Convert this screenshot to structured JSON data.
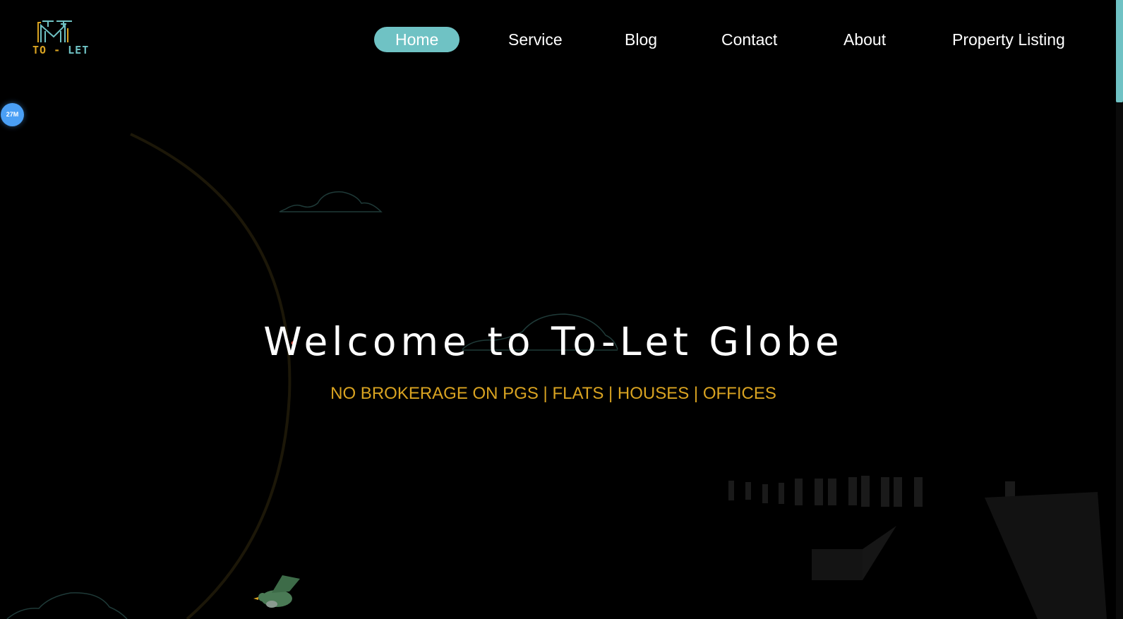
{
  "logo": {
    "text_to": "TO",
    "text_dash": " - ",
    "text_let": "LET"
  },
  "nav": {
    "items": [
      {
        "label": "Home",
        "active": true
      },
      {
        "label": "Service",
        "active": false
      },
      {
        "label": "Blog",
        "active": false
      },
      {
        "label": "Contact",
        "active": false
      },
      {
        "label": "About",
        "active": false
      },
      {
        "label": "Property Listing",
        "active": false
      }
    ]
  },
  "badge": {
    "label": "27M"
  },
  "hero": {
    "title": "Welcome to To-Let Globe",
    "subtitle": "NO BROKERAGE ON PGS | FLATS | HOUSES | OFFICES"
  },
  "colors": {
    "background": "#000000",
    "accent_teal": "#6fc2c4",
    "accent_gold": "#d9a321",
    "badge_blue": "#4a9ff5"
  },
  "icons": {
    "logo": "to-let-building-logo",
    "bird": "green-bird-illustration",
    "clouds": "cloud-outline-icon"
  }
}
